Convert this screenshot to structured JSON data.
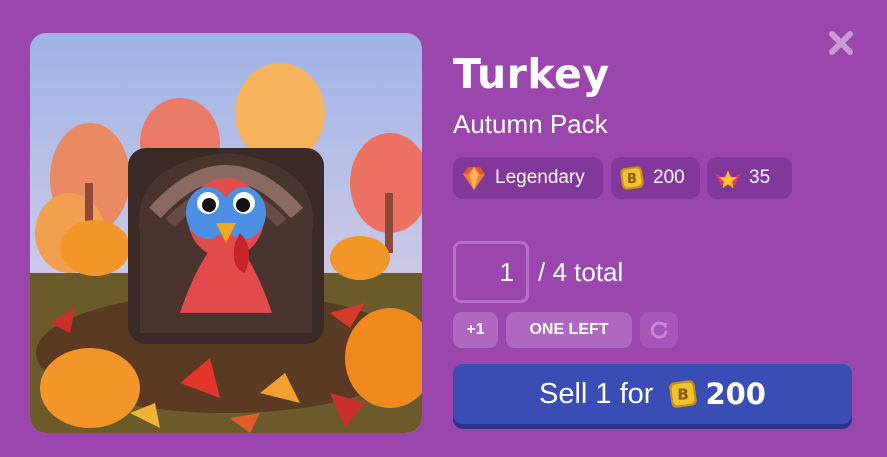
{
  "item": {
    "name": "Turkey",
    "pack": "Autumn Pack"
  },
  "badges": {
    "rarity": "Legendary",
    "value": "200",
    "xp": "35"
  },
  "quantity": {
    "value": "1",
    "total": "/ 4 total"
  },
  "controls": {
    "plus_label": "+1",
    "one_left_label": "ONE LEFT"
  },
  "sell": {
    "label": "Sell 1 for",
    "price": "200"
  },
  "colors": {
    "background": "#9a46ad",
    "badge_bg": "#82379b",
    "sell_button": "#3a4db5",
    "coin": "#f2c230"
  },
  "icons": {
    "close": "close-icon",
    "rarity": "gem-icon",
    "value": "blook-coin-icon",
    "xp": "star-crown-icon",
    "refresh": "refresh-icon"
  }
}
